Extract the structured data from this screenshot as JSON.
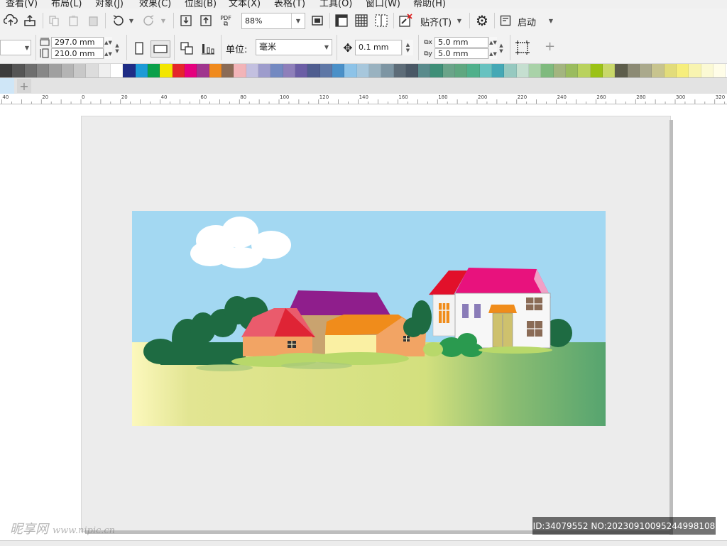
{
  "menu": {
    "items": [
      "查看(V)",
      "布局(L)",
      "对象(J)",
      "效果(C)",
      "位图(B)",
      "文本(X)",
      "表格(T)",
      "工具(O)",
      "窗口(W)",
      "帮助(H)"
    ]
  },
  "toolbar1": {
    "zoom_value": "88%",
    "snap_label": "贴齐(T)",
    "launch_label": "启动",
    "pdf_label": "PDF"
  },
  "toolbar2": {
    "width_value": "297.0 mm",
    "height_value": "210.0 mm",
    "units_label": "单位:",
    "units_value": "毫米",
    "nudge_value": "0.1 mm",
    "dup_x_value": "5.0 mm",
    "dup_y_value": "5.0 mm",
    "add_label": "+"
  },
  "palette": {
    "colors": [
      "#3c3c3c",
      "#555555",
      "#6e6e6e",
      "#878787",
      "#a0a0a0",
      "#b4b4b4",
      "#c8c8c8",
      "#dcdcdc",
      "#efefef",
      "#ffffff",
      "#1f2d86",
      "#1c9ad6",
      "#0aa04a",
      "#f3e600",
      "#e5262b",
      "#e5007e",
      "#a0358e",
      "#f08a1d",
      "#8a6b56",
      "#f2b4b8",
      "#c3c0e0",
      "#9d9ccc",
      "#7389c1",
      "#8e7fba",
      "#6b5ea5",
      "#4f5d8f",
      "#5e77a6",
      "#4a90c8",
      "#8dc3e8",
      "#a7c7dc",
      "#99b2c0",
      "#7d95a3",
      "#5d6c78",
      "#4a5866",
      "#598b8c",
      "#3f8f78",
      "#6aa489",
      "#5fa780",
      "#4fb08b",
      "#67c2c0",
      "#44a8b5",
      "#96c9c0",
      "#c5dfd0",
      "#a9d2a8",
      "#7fba7e",
      "#a3b57f",
      "#9abc5e",
      "#b9d25d",
      "#9bc216",
      "#c9d86a",
      "#5d5d4b",
      "#8c8a74",
      "#aaa98c",
      "#c8c48e",
      "#e2dc7a",
      "#f6ee7c",
      "#f8f4b0",
      "#fbf9d4",
      "#fffde8"
    ]
  },
  "ruler": {
    "ticks": [
      "40",
      "20",
      "0",
      "20",
      "40",
      "60",
      "80",
      "100",
      "120",
      "140",
      "160",
      "180",
      "200",
      "220",
      "240",
      "260",
      "280",
      "300",
      "320"
    ]
  },
  "tabs": {
    "add_label": "+"
  },
  "watermark": {
    "left_text": "昵享网",
    "left_url": "www.nipic.cn",
    "id_text": "ID:34079552 NO:20230910095244998108"
  }
}
